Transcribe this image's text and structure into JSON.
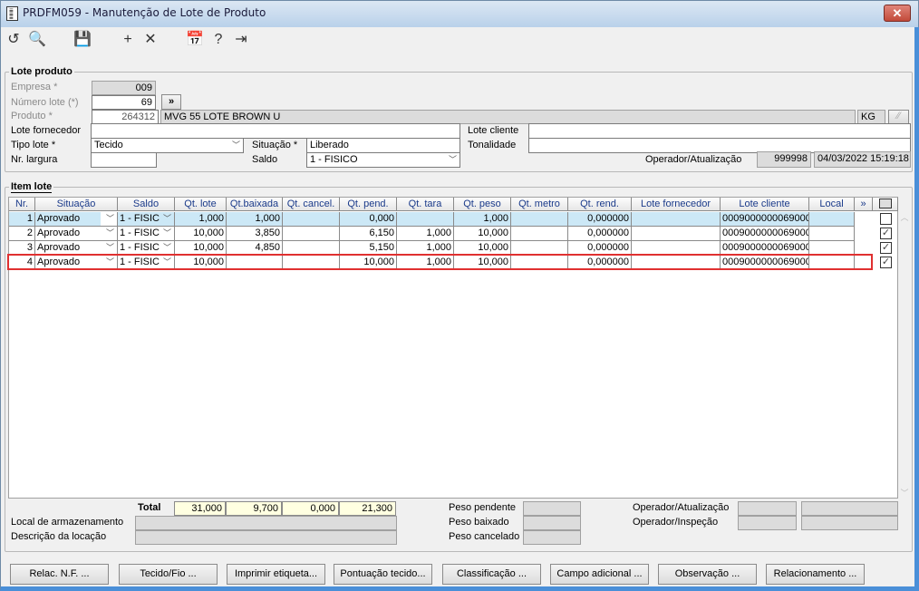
{
  "window": {
    "title": "PRDFM059 - Manutenção de Lote de Produto",
    "close": "✕"
  },
  "toolbar": [
    {
      "icon": "undo-icon",
      "g": "↺"
    },
    {
      "icon": "search-icon",
      "g": "🔍"
    },
    {
      "icon": "save-icon",
      "g": "💾"
    },
    {
      "icon": "add-icon",
      "g": "+"
    },
    {
      "icon": "delete-icon",
      "g": "✕"
    },
    {
      "icon": "calendar-icon",
      "g": "📅"
    },
    {
      "icon": "help-icon",
      "g": "?"
    },
    {
      "icon": "exit-icon",
      "g": "⇥"
    }
  ],
  "lote": {
    "legend": "Lote produto",
    "empresa_label": "Empresa *",
    "empresa": "009",
    "numero_label": "Número lote (*)",
    "numero": "69",
    "more": "»",
    "produto_label": "Produto *",
    "produto": "264312",
    "produto_desc": "MVG 55 LOTE BROWN U",
    "unidade": "KG",
    "lote_fornecedor_label": "Lote fornecedor",
    "lote_fornecedor": "",
    "lote_cliente_label": "Lote cliente",
    "lote_cliente": "",
    "tipo_lote_label": "Tipo lote *",
    "tipo_lote": "Tecido",
    "situacao_label": "Situação *",
    "situacao": "Liberado",
    "tonalidade_label": "Tonalidade",
    "tonalidade": "",
    "nr_largura_label": "Nr. largura",
    "nr_largura": "",
    "saldo_label": "Saldo",
    "saldo": "1 - FISICO",
    "operador_label": "Operador/Atualização",
    "operador": "999998",
    "data": "04/03/2022 15:19:18"
  },
  "item": {
    "legend": "Item lote",
    "columns": [
      "Nr.",
      "Situação",
      "Saldo",
      "Qt. lote",
      "Qt.baixada",
      "Qt. cancel.",
      "Qt. pend.",
      "Qt. tara",
      "Qt. peso",
      "Qt. metro",
      "Qt. rend.",
      "Lote fornecedor",
      "Lote cliente",
      "Local",
      "»"
    ],
    "rows": [
      [
        "1",
        "Aprovado",
        "1 - FISIC",
        "1,000",
        "1,000",
        "",
        "0,000",
        "",
        "1,000",
        "",
        "0,000000",
        "",
        "0009000000069000",
        ""
      ],
      [
        "2",
        "Aprovado",
        "1 - FISIC",
        "10,000",
        "3,850",
        "",
        "6,150",
        "1,000",
        "10,000",
        "",
        "0,000000",
        "",
        "0009000000069000",
        ""
      ],
      [
        "3",
        "Aprovado",
        "1 - FISIC",
        "10,000",
        "4,850",
        "",
        "5,150",
        "1,000",
        "10,000",
        "",
        "0,000000",
        "",
        "0009000000069000",
        ""
      ],
      [
        "4",
        "Aprovado",
        "1 - FISIC",
        "10,000",
        "",
        "",
        "10,000",
        "1,000",
        "10,000",
        "",
        "0,000000",
        "",
        "0009000000069000",
        ""
      ]
    ],
    "checked": [
      false,
      true,
      true,
      true
    ]
  },
  "totals": {
    "label": "Total",
    "values": [
      "31,000",
      "9,700",
      "0,000",
      "21,300"
    ]
  },
  "footer": {
    "local_label": "Local de armazenamento",
    "descricao_label": "Descrição da locação",
    "peso_pendente": "Peso pendente",
    "peso_baixado": "Peso baixado",
    "peso_cancelado": "Peso cancelado",
    "op_atualizacao": "Operador/Atualização",
    "op_inspecao": "Operador/Inspeção"
  },
  "buttons": [
    "Relac. N.F. ...",
    "Tecido/Fio ...",
    "Imprimir etiqueta...",
    "Pontuação tecido...",
    "Classificação ...",
    "Campo adicional ...",
    "Observação ...",
    "Relacionamento ..."
  ],
  "colors": {
    "selected_row": "#cce8f6",
    "highlight": "#e03030",
    "totals_bg": "#ffffe1"
  }
}
